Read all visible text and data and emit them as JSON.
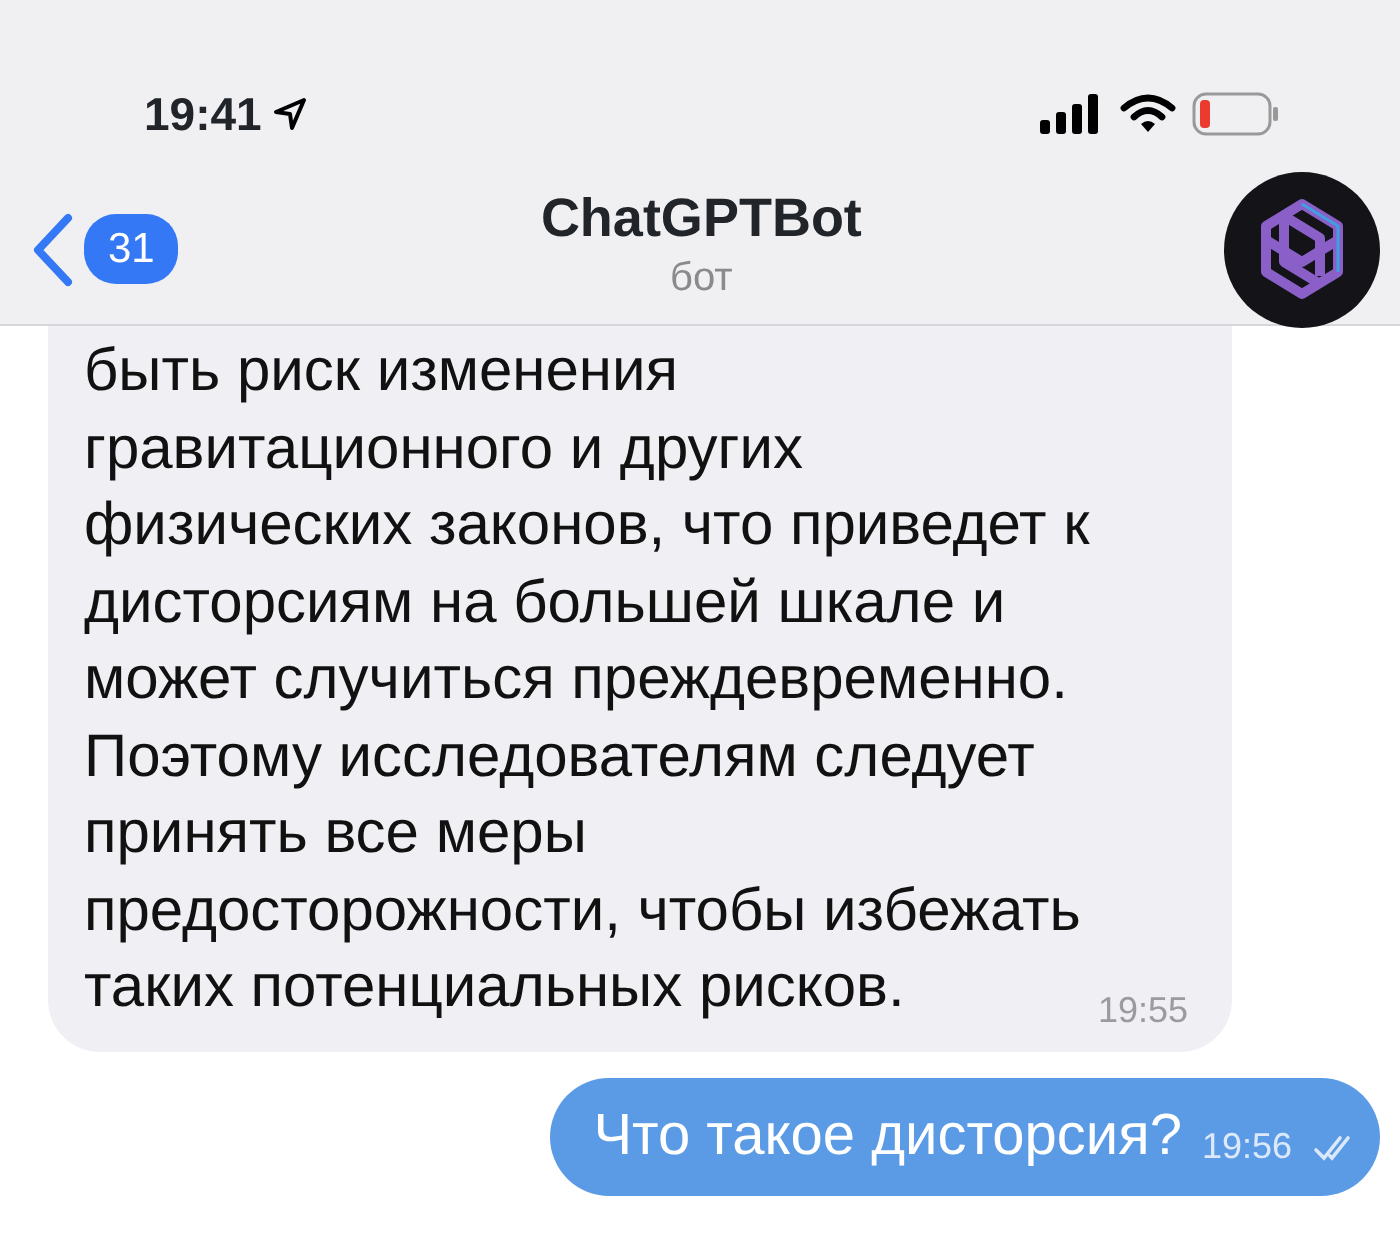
{
  "status_bar": {
    "time": "19:41"
  },
  "header": {
    "back_count": "31",
    "title": "ChatGPTBot",
    "subtitle": "бот"
  },
  "messages": [
    {
      "kind": "incoming",
      "text": "быть риск изменения\nгравитационного и других\nфизических законов, что приведет к\nдисторсиям на большей шкале и\nможет случиться преждевременно.\nПоэтому исследователям следует\nпринять все меры\nпредосторожности, чтобы избежать\nтаких потенциальных рисков.",
      "time": "19:55"
    },
    {
      "kind": "outgoing",
      "text": "Что такое дисторсия?",
      "time": "19:56",
      "read": true
    }
  ]
}
